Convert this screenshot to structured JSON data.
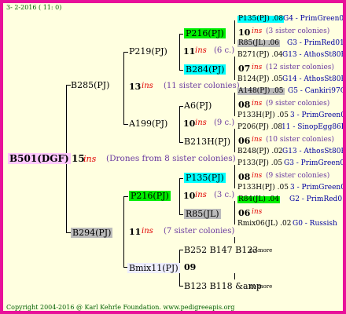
{
  "header": "3-  2-2016 ( 11: 0)",
  "footer": "Copyright 2004-2016 @ Karl Kehrle Foundation.   www.pedigreeapis.org",
  "root": {
    "label": "B501(DGF)",
    "num": "15",
    "ins": "ins",
    "note": "(Drones from 8 sister colonies)"
  },
  "g1_top": {
    "label": "B285(PJ)",
    "num": "13",
    "ins": "ins",
    "note": "(11 sister colonies)"
  },
  "g1_bot": {
    "label": "B294(PJ)",
    "num": "11",
    "ins": "ins",
    "note": "(7 sister colonies)"
  },
  "g2_p219": {
    "label": "P219(PJ)",
    "num": "11",
    "ins": "ins",
    "note": "(6 c.)"
  },
  "g2_a199": {
    "label": "A199(PJ)",
    "num": "10",
    "ins": "ins",
    "note": "(9 c.)"
  },
  "g2_p216": {
    "label": "P216(PJ)",
    "num": "10",
    "ins": "ins",
    "note": "(3 c.)"
  },
  "g2_bmix": {
    "label": "Bmix11(PJ)",
    "num": "09"
  },
  "g3": [
    {
      "label": "P216(PJ)"
    },
    {
      "label": "B284(PJ)"
    },
    {
      "label": "A6(PJ)"
    },
    {
      "label": "B213H(PJ)"
    },
    {
      "label": "P135(PJ)"
    },
    {
      "label": "R85(JL)"
    },
    {
      "label": "B252 B147 B123",
      "suffix": "no more"
    },
    {
      "label": "B123 B118 &amp",
      "suffix": "no more"
    }
  ],
  "r": {
    "r1a": {
      "pre": "P135(PJ) .08",
      "post": "G4 - PrimGreen00"
    },
    "r1b": {
      "num": "10",
      "ins": "ins",
      "note": "(3 sister colonies)"
    },
    "r1c": {
      "pre": "R85(JL) .06",
      "post": "G3 - PrimRed01"
    },
    "r2a": {
      "pre": "B271(PJ) .04",
      "post": "G13 - AthosSt80R"
    },
    "r2b": {
      "num": "07",
      "ins": "ins",
      "note": "(12 sister colonies)"
    },
    "r2c": {
      "pre": "B124(PJ) .05",
      "post": "G14 - AthosSt80R"
    },
    "r3a": {
      "pre": "A148(PJ) .05",
      "post": "G5 - Cankiri97Q"
    },
    "r3b": {
      "num": "08",
      "ins": "ins",
      "note": "(9 sister colonies)"
    },
    "r3c": {
      "pre": "P133H(PJ) .05",
      "post": "3 - PrimGreen00"
    },
    "r4a": {
      "pre": "P206(PJ) .08",
      "post": "11 - SinopEgg86R"
    },
    "r4b": {
      "num": "06",
      "ins": "ins",
      "note": "(10 sister colonies)"
    },
    "r4c": {
      "pre": "B248(PJ) .02",
      "post": "G13 - AthosSt80R"
    },
    "r5a": {
      "pre": "P133(PJ) .05",
      "post": "G3 - PrimGreen00"
    },
    "r5b": {
      "num": "08",
      "ins": "ins",
      "note": "(9 sister colonies)"
    },
    "r5c": {
      "pre": "P133H(PJ) .05",
      "post": "3 - PrimGreen00"
    },
    "r6a": {
      "pre": "R84(JL) .04",
      "post": "G2 - PrimRed01"
    },
    "r6b": {
      "num": "06",
      "ins": "ins"
    },
    "r6c": {
      "pre": "Rmix06(JL) .02",
      "post": "G0 - Russish"
    }
  },
  "colors": {
    "border": "#e8109a",
    "background": "#ffffe0",
    "green_hl": "#00ee00",
    "cyan_hl": "#00ffff",
    "gray_hl": "#bbbbbb",
    "root_hl": "#ffc8ff",
    "ins": "#e00000",
    "note": "#6a3aa0"
  }
}
